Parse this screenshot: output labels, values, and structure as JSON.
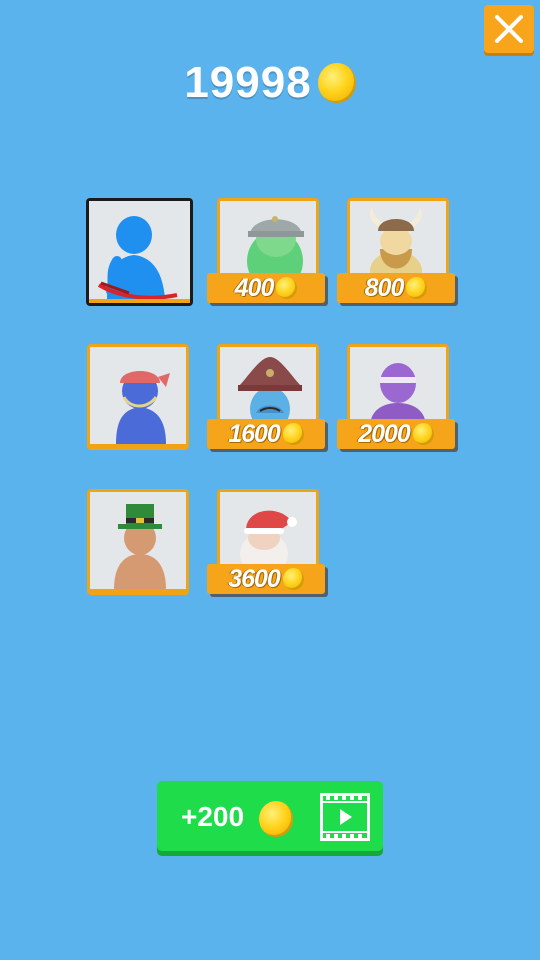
{
  "header": {
    "coins": "19998",
    "coin_icon": "gold-coin-icon"
  },
  "close_button": {
    "icon": "close-icon"
  },
  "skins": [
    {
      "id": "blue-archer",
      "state": "selected",
      "price": null
    },
    {
      "id": "soldier",
      "state": "locked",
      "price": "400"
    },
    {
      "id": "viking",
      "state": "locked",
      "price": "800"
    },
    {
      "id": "red-bandana",
      "state": "owned",
      "price": null
    },
    {
      "id": "pirate",
      "state": "locked",
      "price": "1600"
    },
    {
      "id": "ninja",
      "state": "locked",
      "price": "2000"
    },
    {
      "id": "leprechaun",
      "state": "owned",
      "price": null
    },
    {
      "id": "santa",
      "state": "locked",
      "price": "3600"
    }
  ],
  "reward_button": {
    "label": "+200",
    "icon": "video-ad-icon"
  },
  "colors": {
    "background": "#5bb3ee",
    "accent_orange": "#f6a51b",
    "reward_green": "#1fdc4b",
    "coin_gold": "#ffd21a"
  }
}
